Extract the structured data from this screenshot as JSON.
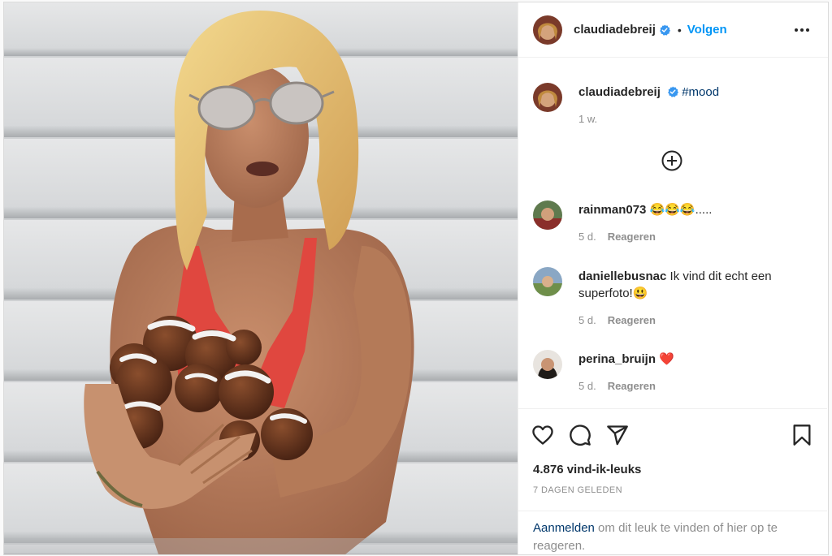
{
  "header": {
    "username": "claudiadebreij",
    "separator": "•",
    "follow_label": "Volgen"
  },
  "caption": {
    "username": "claudiadebreij",
    "text": "#mood",
    "time": "1 w."
  },
  "comments": [
    {
      "username": "rainman073",
      "text": " 😂😂😂.....",
      "time": "5 d.",
      "reply_label": "Reageren"
    },
    {
      "username": "daniellebusnac",
      "text": " Ik vind dit echt een superfoto!😃",
      "time": "5 d.",
      "reply_label": "Reageren"
    },
    {
      "username": "perina_bruijn",
      "text": " ❤️",
      "time": "5 d.",
      "reply_label": "Reageren"
    }
  ],
  "actions": {
    "likes": "4.876 vind-ik-leuks",
    "date": "7 DAGEN GELEDEN"
  },
  "login": {
    "link": "Aanmelden",
    "text": " om dit leuk te vinden of hier op te reageren."
  },
  "icons": [
    "verified-badge-icon",
    "more-options-icon",
    "load-more-icon",
    "heart-icon",
    "comment-icon",
    "share-icon",
    "bookmark-icon"
  ],
  "colors": {
    "accent": "#0095f6",
    "link": "#00376b",
    "muted": "#8e8e8e",
    "border": "#dbdbdb"
  }
}
